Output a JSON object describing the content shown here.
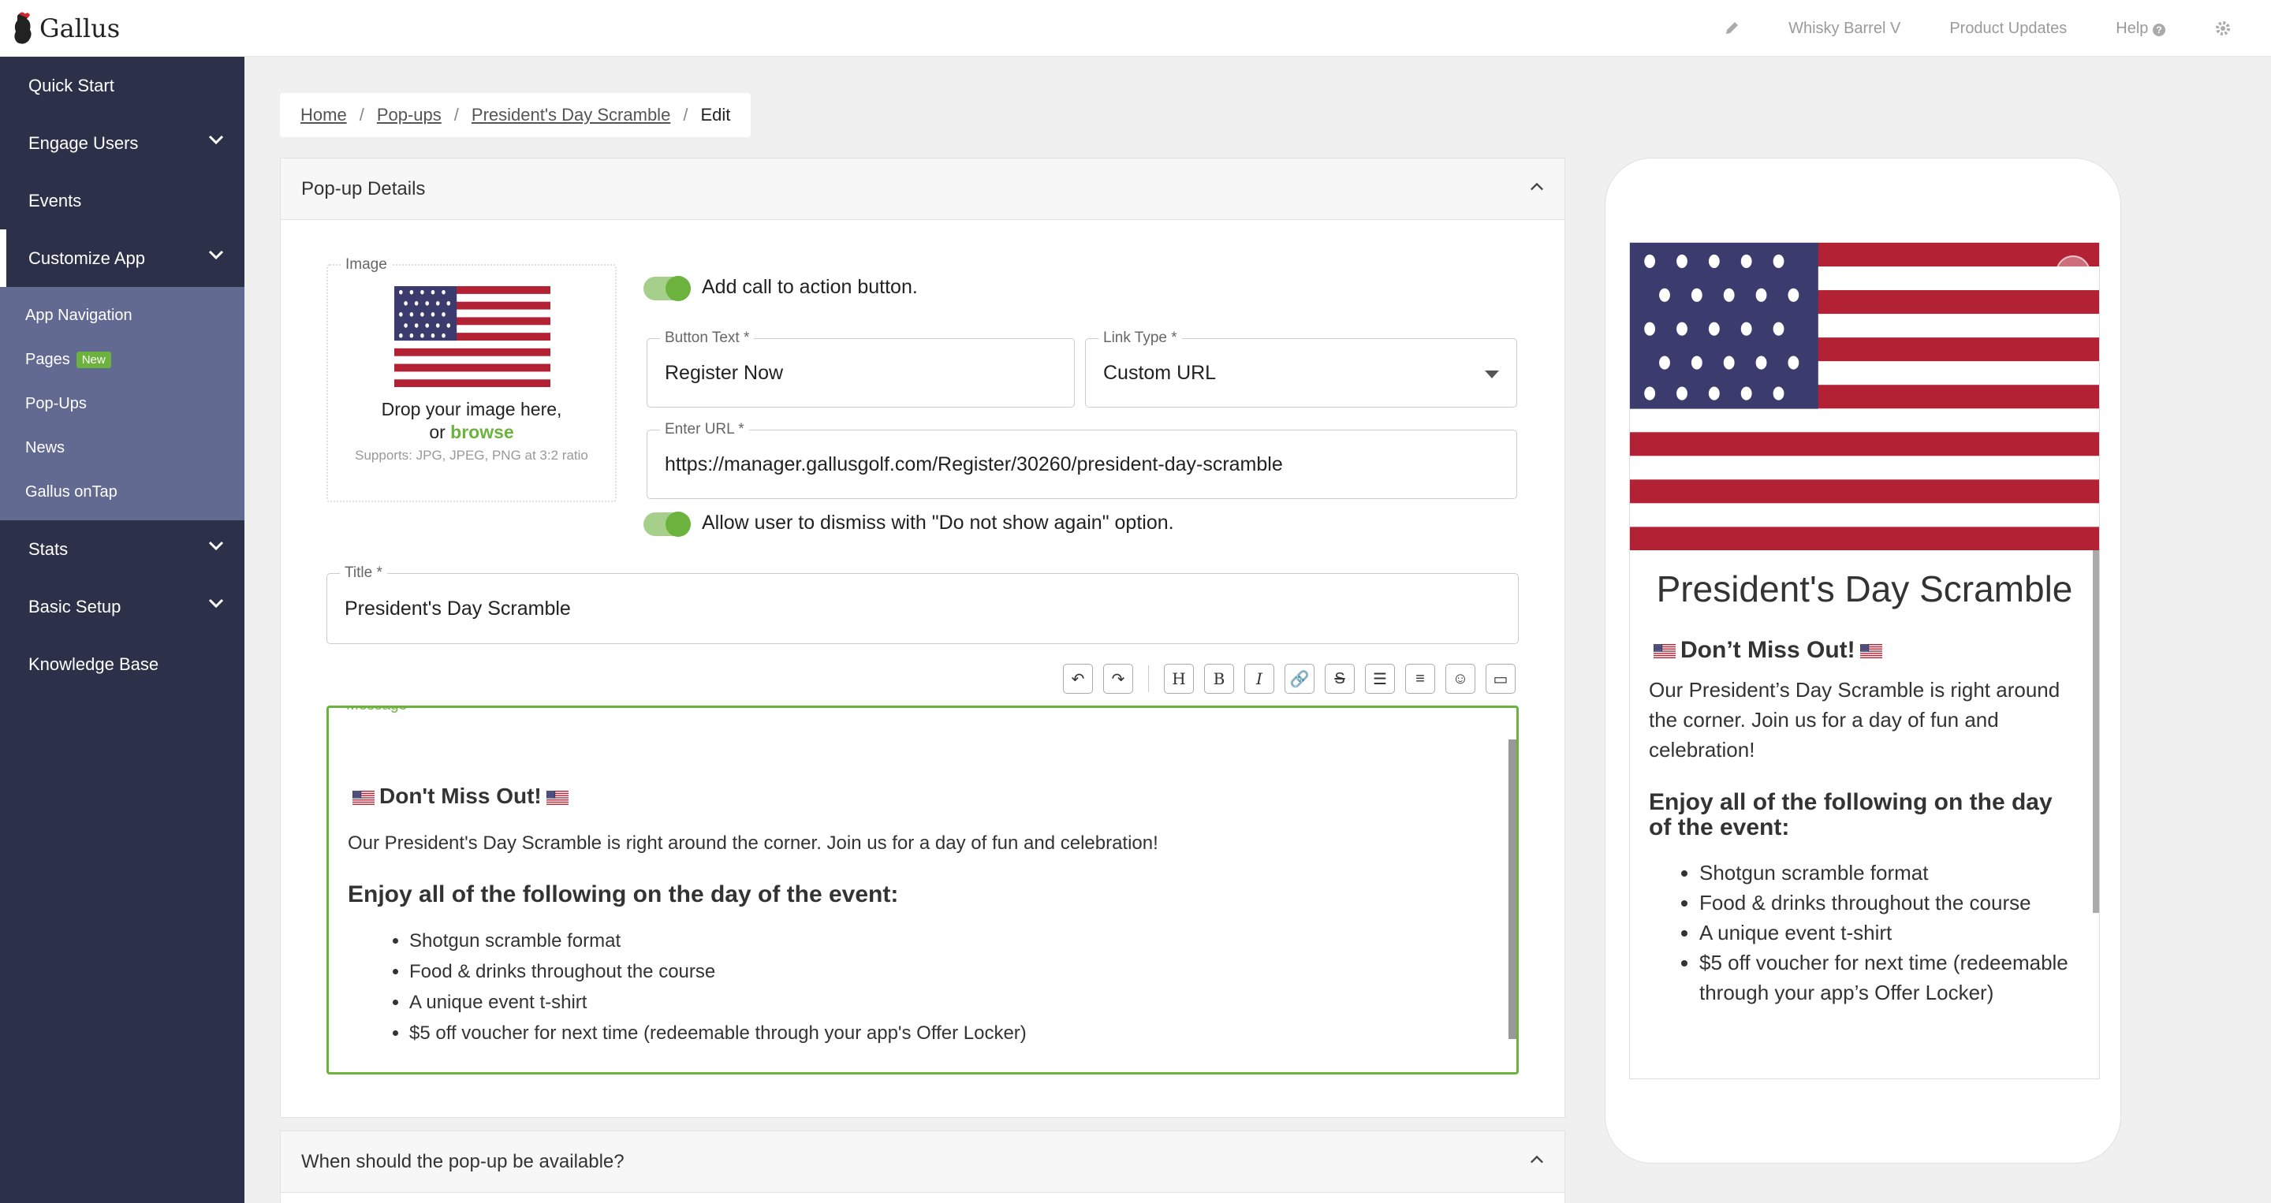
{
  "app": {
    "name": "Gallus"
  },
  "topnav": {
    "club": "Whisky Barrel V",
    "updates": "Product Updates",
    "help": "Help"
  },
  "sidebar": {
    "items": [
      {
        "label": "Quick Start"
      },
      {
        "label": "Engage Users"
      },
      {
        "label": "Events"
      },
      {
        "label": "Customize App"
      },
      {
        "label": "Stats"
      },
      {
        "label": "Basic Setup"
      },
      {
        "label": "Knowledge Base"
      }
    ],
    "sub": [
      {
        "label": "App Navigation"
      },
      {
        "label": "Pages",
        "badge": "New"
      },
      {
        "label": "Pop-Ups"
      },
      {
        "label": "News"
      },
      {
        "label": "Gallus onTap"
      }
    ]
  },
  "breadcrumb": {
    "home": "Home",
    "popups": "Pop-ups",
    "item": "President's Day Scramble",
    "current": "Edit"
  },
  "popup_details": {
    "heading": "Pop-up Details",
    "image": {
      "label": "Image",
      "drop": "Drop your image here,",
      "or": "or",
      "browse": "browse",
      "supports": "Supports: JPG, JPEG, PNG at 3:2 ratio"
    },
    "cta_toggle": "Add call to action button.",
    "button_text": {
      "label": "Button Text *",
      "value": "Register Now"
    },
    "link_type": {
      "label": "Link Type *",
      "value": "Custom URL"
    },
    "url": {
      "label": "Enter URL *",
      "value": "https://manager.gallusgolf.com/Register/30260/president-day-scramble"
    },
    "dismiss_toggle": "Allow user to dismiss with \"Do not show again\" option.",
    "title": {
      "label": "Title *",
      "value": "President's Day Scramble"
    },
    "message": {
      "label": "Message *",
      "heading": "Don't Miss Out!",
      "intro": "Our President's Day Scramble is right around the corner. Join us for a day of fun and celebration!",
      "subheading": "Enjoy all of the following on the day of the event:",
      "items": [
        "Shotgun scramble format",
        "Food & drinks throughout the course",
        "A unique event t-shirt",
        "$5 off voucher for next time (redeemable through your app's Offer Locker)"
      ]
    }
  },
  "availability": {
    "heading": "When should the pop-up be available?"
  },
  "preview": {
    "title": "President's Day Scramble",
    "heading": "Don’t Miss Out!",
    "intro": "Our President’s Day Scramble is right around the corner. Join us for a day of fun and celebration!",
    "subheading": "Enjoy all of the following on the day of the event:",
    "items": [
      "Shotgun scramble format",
      "Food & drinks throughout the course",
      "A unique event t-shirt",
      "$5 off voucher for next time (redeemable through your app’s Offer Locker)"
    ]
  }
}
